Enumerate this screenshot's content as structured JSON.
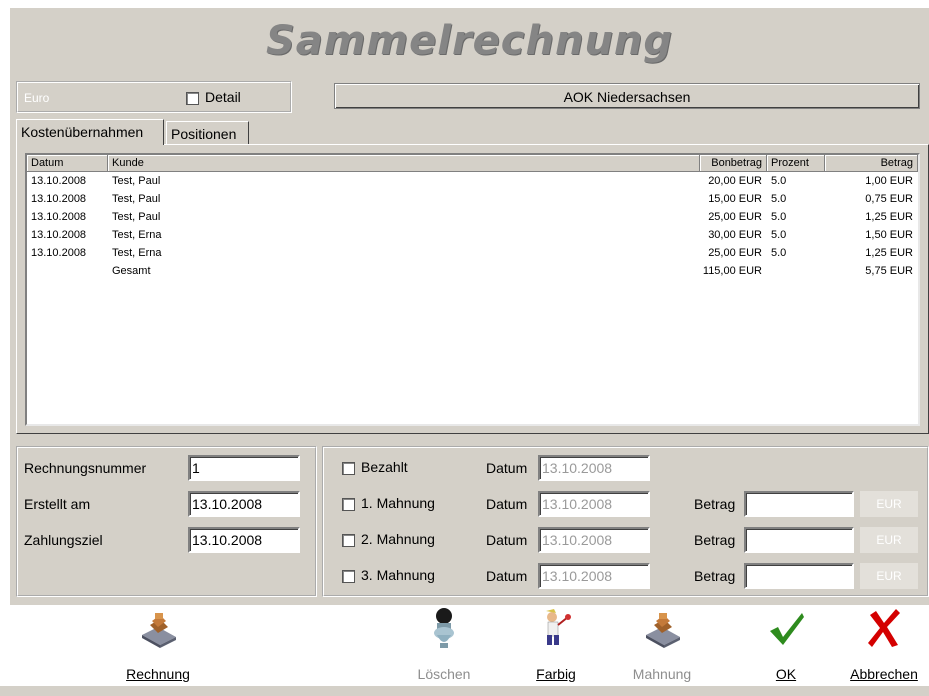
{
  "title": "Sammelrechnung",
  "euro_field": "Euro",
  "detail_label": "Detail",
  "insurer": "AOK Niedersachsen",
  "tabs": [
    {
      "label": "Kostenübernahmen"
    },
    {
      "label": "Positionen"
    }
  ],
  "list": {
    "headers": [
      "Datum",
      "Kunde",
      "Bonbetrag",
      "Prozent",
      "Betrag"
    ],
    "rows": [
      {
        "datum": "13.10.2008",
        "kunde": "Test, Paul",
        "bonbetrag": "20,00 EUR",
        "prozent": "5.0",
        "betrag": "1,00 EUR"
      },
      {
        "datum": "13.10.2008",
        "kunde": "Test, Paul",
        "bonbetrag": "15,00 EUR",
        "prozent": "5.0",
        "betrag": "0,75 EUR"
      },
      {
        "datum": "13.10.2008",
        "kunde": "Test, Paul",
        "bonbetrag": "25,00 EUR",
        "prozent": "5.0",
        "betrag": "1,25 EUR"
      },
      {
        "datum": "13.10.2008",
        "kunde": "Test, Erna",
        "bonbetrag": "30,00 EUR",
        "prozent": "5.0",
        "betrag": "1,50 EUR"
      },
      {
        "datum": "13.10.2008",
        "kunde": "Test, Erna",
        "bonbetrag": "25,00 EUR",
        "prozent": "5.0",
        "betrag": "1,25 EUR"
      },
      {
        "datum": "",
        "kunde": "Gesamt",
        "bonbetrag": "115,00 EUR",
        "prozent": "",
        "betrag": "5,75 EUR"
      }
    ]
  },
  "invoice": {
    "nr_label": "Rechnungsnummer",
    "nr_value": "1",
    "created_label": "Erstellt am",
    "created_value": "13.10.2008",
    "due_label": "Zahlungsziel",
    "due_value": "13.10.2008"
  },
  "payment": {
    "datum_label": "Datum",
    "betrag_label": "Betrag",
    "eur_label": "EUR",
    "bezahlt": {
      "label": "Bezahlt",
      "date": "13.10.2008"
    },
    "mahnungen": [
      {
        "label": "1. Mahnung",
        "date": "13.10.2008",
        "amount": ""
      },
      {
        "label": "2. Mahnung",
        "date": "13.10.2008",
        "amount": ""
      },
      {
        "label": "3. Mahnung",
        "date": "13.10.2008",
        "amount": ""
      }
    ]
  },
  "toolbar": {
    "rechnung": "Rechnung",
    "loeschen": "Löschen",
    "farbig": "Farbig",
    "mahnung": "Mahnung",
    "ok": "OK",
    "abbrechen": "Abbrechen"
  },
  "icons": {
    "rechnung": "rubber-stamp-icon",
    "loeschen": "toilet-icon",
    "farbig": "painter-icon",
    "mahnung": "rubber-stamp-icon",
    "ok": "check-mark-icon",
    "abbrechen": "red-x-icon"
  },
  "colors": {
    "ok": "#2e8b1e",
    "cancel": "#d40000",
    "title": "#858585"
  }
}
